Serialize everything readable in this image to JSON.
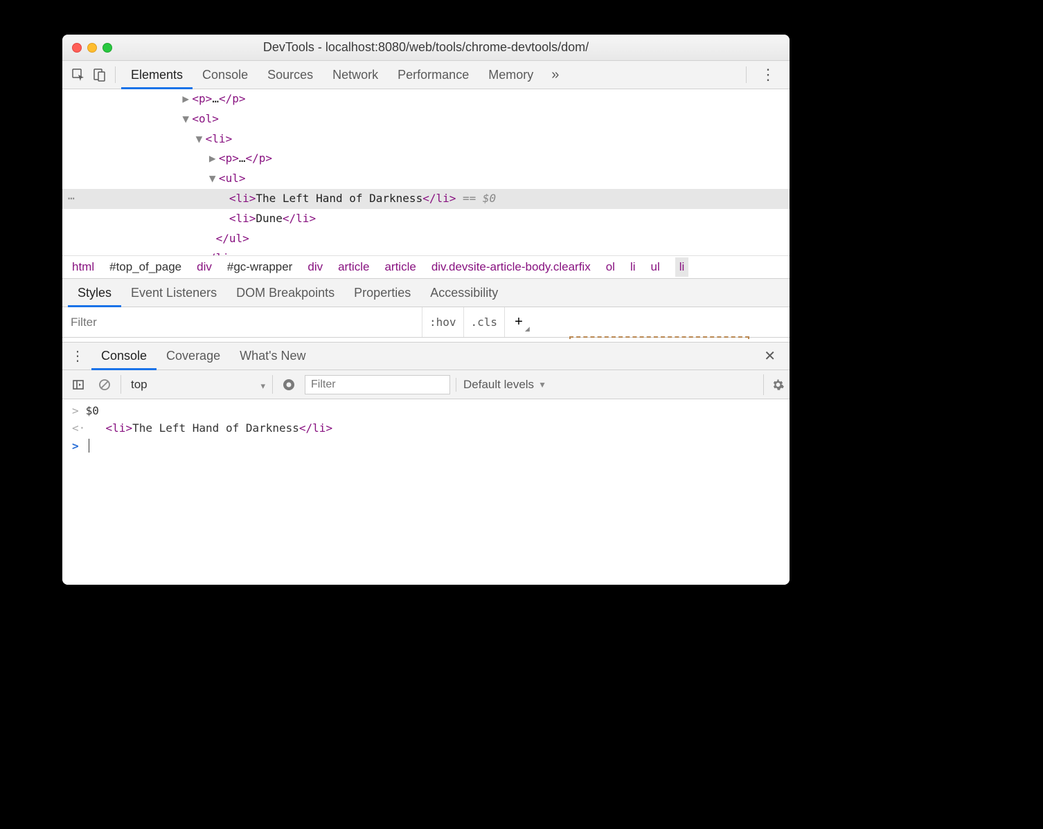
{
  "title": "DevTools - localhost:8080/web/tools/chrome-devtools/dom/",
  "tabs": {
    "elements": "Elements",
    "console": "Console",
    "sources": "Sources",
    "network": "Network",
    "performance": "Performance",
    "memory": "Memory"
  },
  "dom": {
    "line1_tag": "p",
    "line1_ell": "…",
    "line2_tag": "ol",
    "line3_tag": "li",
    "line4_tag": "p",
    "line4_ell": "…",
    "line5_tag": "ul",
    "selected_tag": "li",
    "selected_text": "The Left Hand of Darkness",
    "selected_suffix": " == $0",
    "line7_tag": "li",
    "line7_text": "Dune",
    "line8_close": "ul",
    "line9_close": "li"
  },
  "breadcrumbs": [
    "html",
    "#top_of_page",
    "div",
    "#gc-wrapper",
    "div",
    "article",
    "article",
    "div.devsite-article-body.clearfix",
    "ol",
    "li",
    "ul",
    "li"
  ],
  "styles_tabs": {
    "styles": "Styles",
    "event": "Event Listeners",
    "dom": "DOM Breakpoints",
    "props": "Properties",
    "a11y": "Accessibility"
  },
  "filter_placeholder": "Filter",
  "hov": ":hov",
  "cls": ".cls",
  "drawer_tabs": {
    "console": "Console",
    "coverage": "Coverage",
    "whatsnew": "What's New"
  },
  "ctx_default": "top",
  "console_filter_placeholder": "Filter",
  "levels_label": "Default levels",
  "console": {
    "input_sym": ">",
    "output_sym": "<·",
    "prompt_sym": ">",
    "input_text": "$0",
    "output_tag": "li",
    "output_text": "The Left Hand of Darkness"
  }
}
